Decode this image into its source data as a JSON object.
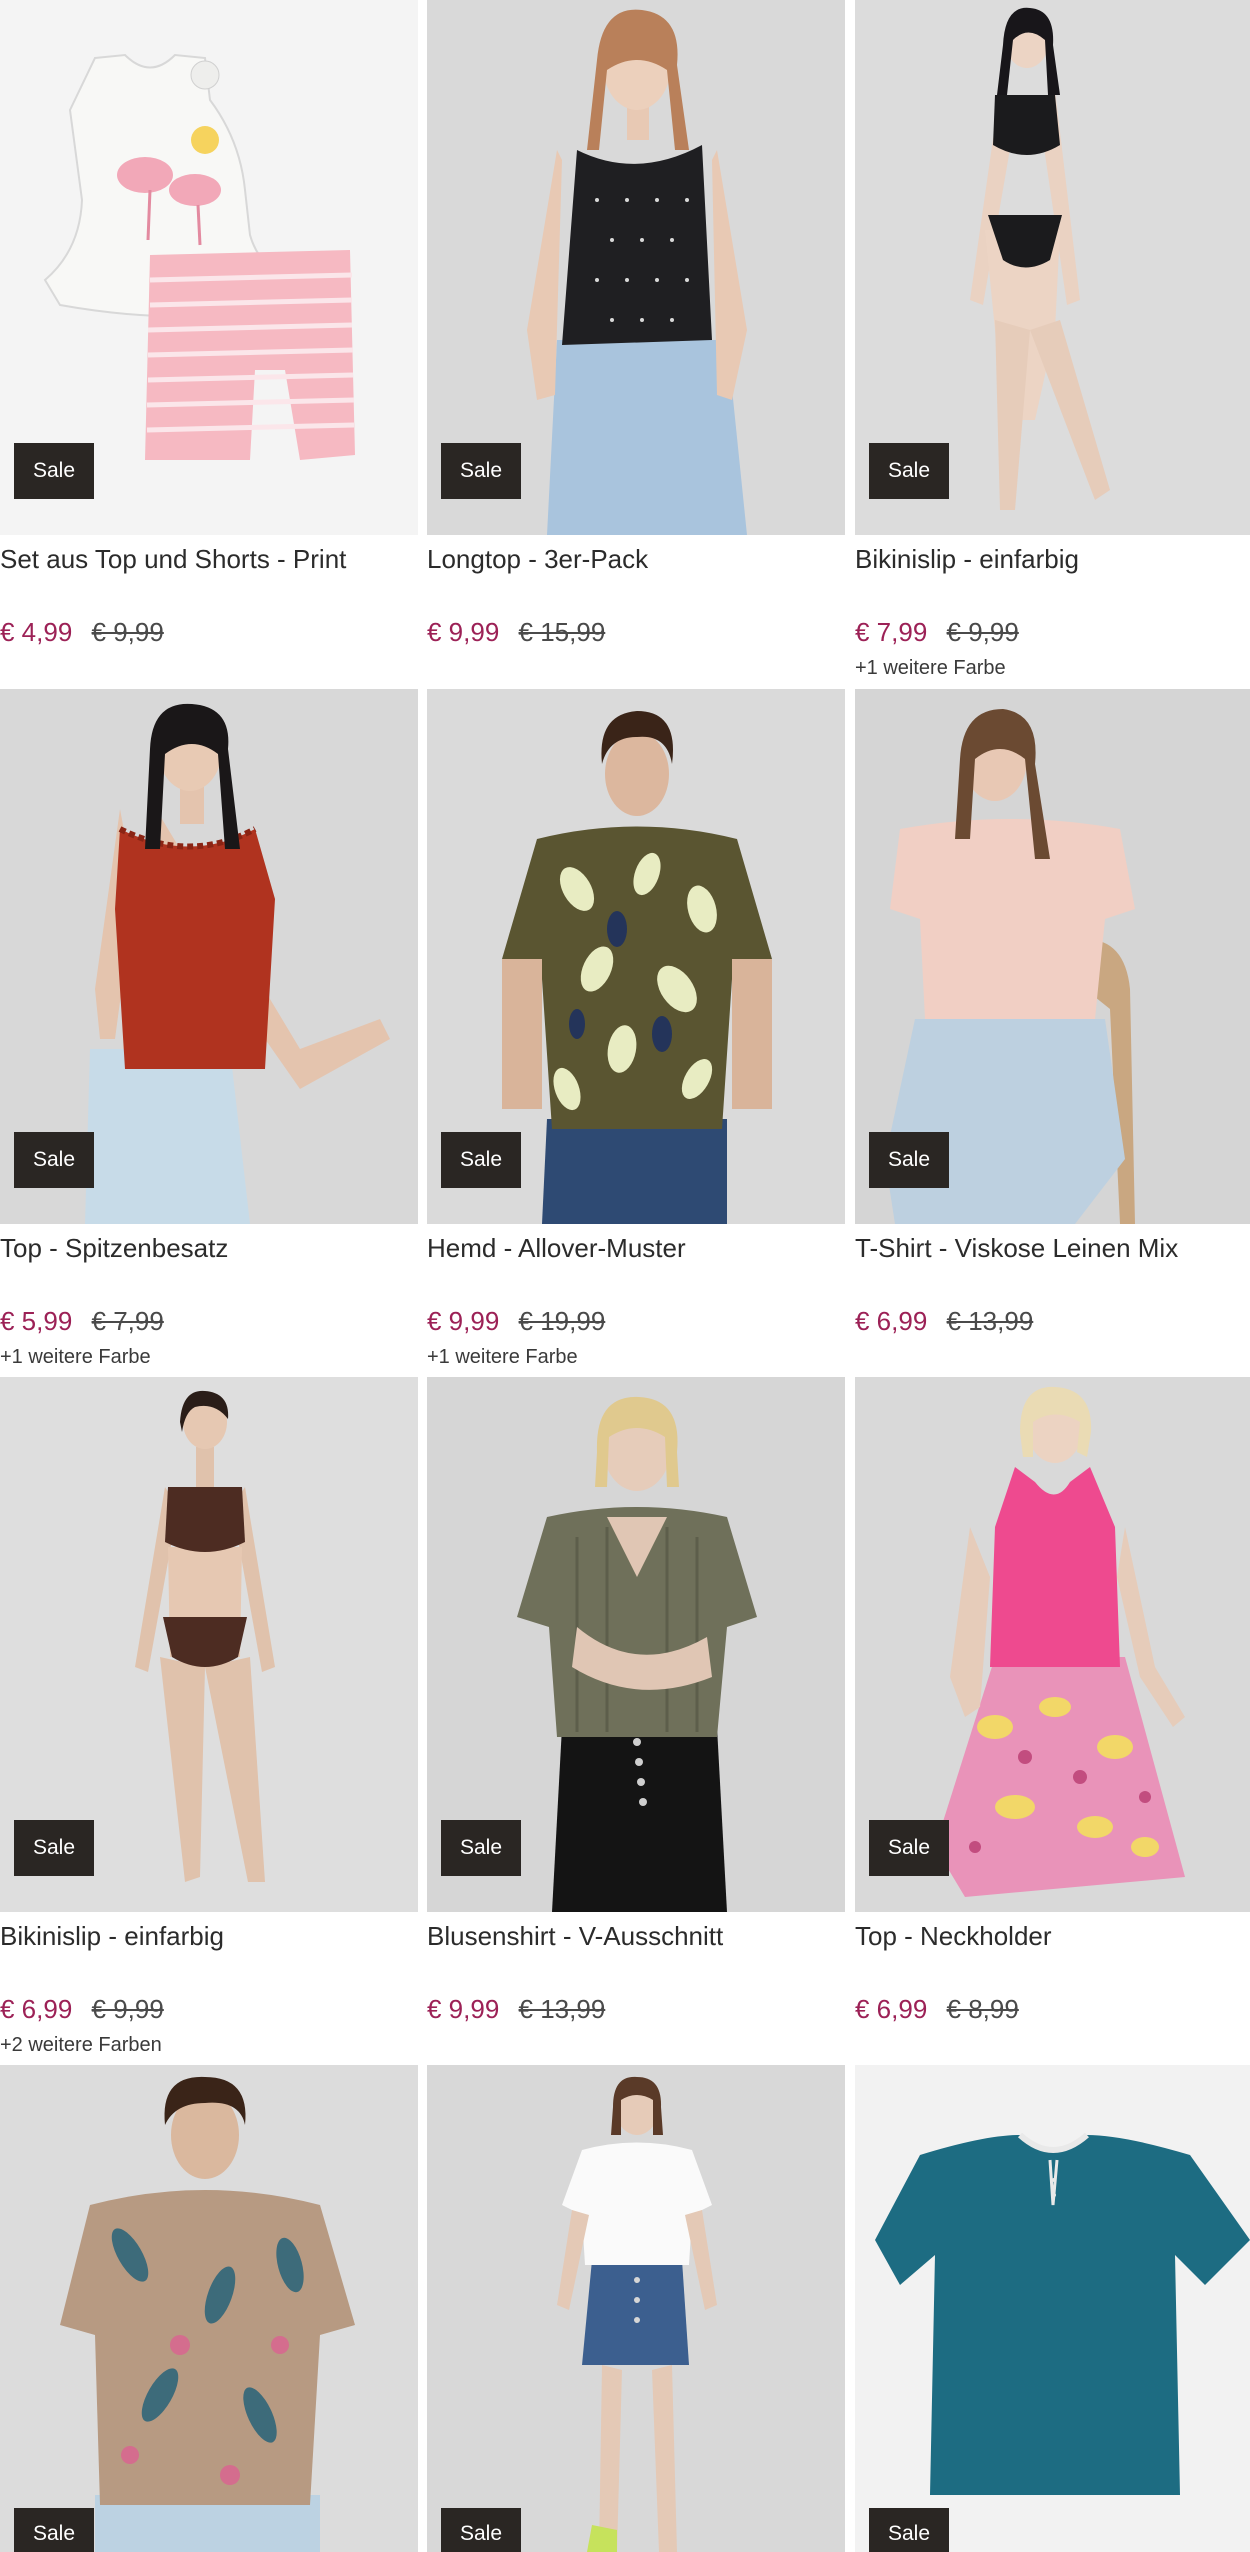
{
  "badge_label": "Sale",
  "colors": {
    "price_now": "#9c2156",
    "badge_bg": "#2a2623",
    "text": "#2b2b2b"
  },
  "products": [
    {
      "title": "Set aus Top und Shorts - Print",
      "price": "€ 4,99",
      "old_price": "€ 9,99",
      "colors_note": "",
      "image": "kids-top-shorts-flamingo"
    },
    {
      "title": "Longtop - 3er-Pack",
      "price": "€ 9,99",
      "old_price": "€ 15,99",
      "colors_note": "",
      "image": "woman-black-dotted-top"
    },
    {
      "title": "Bikinislip - einfarbig",
      "price": "€ 7,99",
      "old_price": "€ 9,99",
      "colors_note": "+1 weitere Farbe",
      "image": "woman-black-bikini"
    },
    {
      "title": "Top - Spitzenbesatz",
      "price": "€ 5,99",
      "old_price": "€ 7,99",
      "colors_note": "+1 weitere Farbe",
      "image": "woman-red-lace-top"
    },
    {
      "title": "Hemd - Allover-Muster",
      "price": "€ 9,99",
      "old_price": "€ 19,99",
      "colors_note": "+1 weitere Farbe",
      "image": "man-leaf-print-shirt"
    },
    {
      "title": "T-Shirt - Viskose Leinen Mix",
      "price": "€ 6,99",
      "old_price": "€ 13,99",
      "colors_note": "",
      "image": "woman-pink-tshirt"
    },
    {
      "title": "Bikinislip - einfarbig",
      "price": "€ 6,99",
      "old_price": "€ 9,99",
      "colors_note": "+2 weitere Farben",
      "image": "woman-brown-bikini"
    },
    {
      "title": "Blusenshirt - V-Ausschnitt",
      "price": "€ 9,99",
      "old_price": "€ 13,99",
      "colors_note": "",
      "image": "woman-olive-blouse"
    },
    {
      "title": "Top - Neckholder",
      "price": "€ 6,99",
      "old_price": "€ 8,99",
      "colors_note": "",
      "image": "woman-pink-halter-top"
    },
    {
      "title": "",
      "price": "",
      "old_price": "",
      "colors_note": "",
      "image": "man-floral-tshirt"
    },
    {
      "title": "",
      "price": "",
      "old_price": "",
      "colors_note": "",
      "image": "woman-white-tee-denim-shorts"
    },
    {
      "title": "",
      "price": "",
      "old_price": "",
      "colors_note": "",
      "image": "teal-henley-shirt"
    }
  ]
}
